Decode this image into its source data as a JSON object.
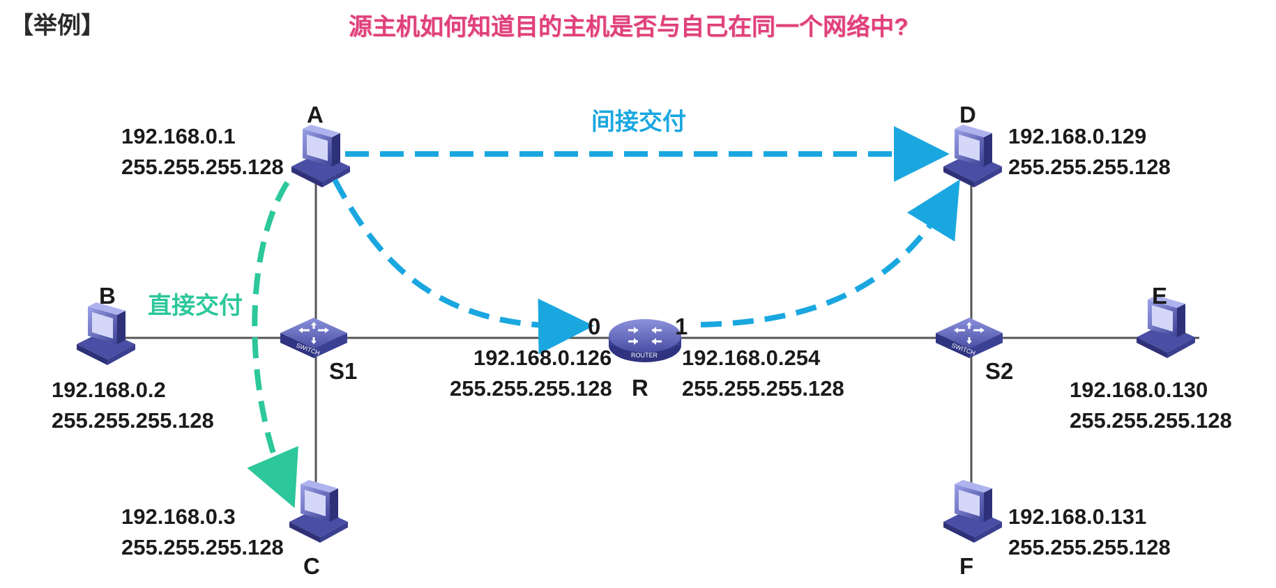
{
  "header": {
    "tag": "【举例】",
    "question": "源主机如何知道目的主机是否与自己在同一个网络中?"
  },
  "delivery": {
    "indirect": "间接交付",
    "direct": "直接交付"
  },
  "hosts": {
    "A": {
      "label": "A",
      "ip": "192.168.0.1",
      "mask": "255.255.255.128"
    },
    "B": {
      "label": "B",
      "ip": "192.168.0.2",
      "mask": "255.255.255.128"
    },
    "C": {
      "label": "C",
      "ip": "192.168.0.3",
      "mask": "255.255.255.128"
    },
    "D": {
      "label": "D",
      "ip": "192.168.0.129",
      "mask": "255.255.255.128"
    },
    "E": {
      "label": "E",
      "ip": "192.168.0.130",
      "mask": "255.255.255.128"
    },
    "F": {
      "label": "F",
      "ip": "192.168.0.131",
      "mask": "255.255.255.128"
    }
  },
  "switches": {
    "S1": {
      "label": "S1",
      "device_text": "SWITCH"
    },
    "S2": {
      "label": "S2",
      "device_text": "SWITCH"
    }
  },
  "router": {
    "label": "R",
    "device_text": "ROUTER",
    "port0": {
      "label": "0",
      "ip": "192.168.0.126",
      "mask": "255.255.255.128"
    },
    "port1": {
      "label": "1",
      "ip": "192.168.0.254",
      "mask": "255.255.255.128"
    }
  },
  "colors": {
    "indirect_arrow": "#1aa7e0",
    "direct_arrow": "#2cc79a",
    "question": "#e0407a",
    "link": "#555555",
    "device": "#5b5fb0"
  }
}
